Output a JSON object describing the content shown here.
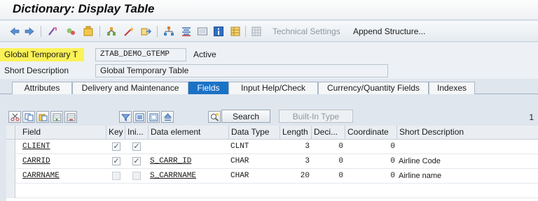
{
  "window": {
    "title": "Dictionary: Display Table"
  },
  "toolbar": {
    "technical_settings": "Technical Settings",
    "append_structure": "Append Structure..."
  },
  "header": {
    "name_label": "Global Temporary T",
    "name_value": "ZTAB_DEMO_GTEMP",
    "status": "Active",
    "short_desc_label": "Short Description",
    "short_desc_value": "Global Temporary Table"
  },
  "tabs": [
    {
      "label": "Attributes",
      "active": false
    },
    {
      "label": "Delivery and Maintenance",
      "active": false
    },
    {
      "label": "Fields",
      "active": true
    },
    {
      "label": "Input Help/Check",
      "active": false
    },
    {
      "label": "Currency/Quantity Fields",
      "active": false
    },
    {
      "label": "Indexes",
      "active": false
    }
  ],
  "fields_toolbar": {
    "search": "Search",
    "built_in_type": "Built-In Type",
    "page_count": "1"
  },
  "table": {
    "columns": [
      "Field",
      "Key",
      "Ini...",
      "Data element",
      "Data Type",
      "Length",
      "Deci...",
      "Coordinate",
      "Short Description"
    ],
    "rows": [
      {
        "field": "CLIENT",
        "key": true,
        "initial": true,
        "data_element": "",
        "data_type": "CLNT",
        "length": "3",
        "decimals": "0",
        "coordinate": "0",
        "short_description": ""
      },
      {
        "field": "CARRID",
        "key": true,
        "initial": true,
        "data_element": "S_CARR_ID",
        "data_type": "CHAR",
        "length": "3",
        "decimals": "0",
        "coordinate": "0",
        "short_description": "Airline Code"
      },
      {
        "field": "CARRNAME",
        "key": false,
        "initial": false,
        "data_element": "S_CARRNAME",
        "data_type": "CHAR",
        "length": "20",
        "decimals": "0",
        "coordinate": "0",
        "short_description": "Airline name"
      }
    ]
  },
  "colors": {
    "active_tab": "#1a72c6",
    "highlight": "#fbf257"
  }
}
